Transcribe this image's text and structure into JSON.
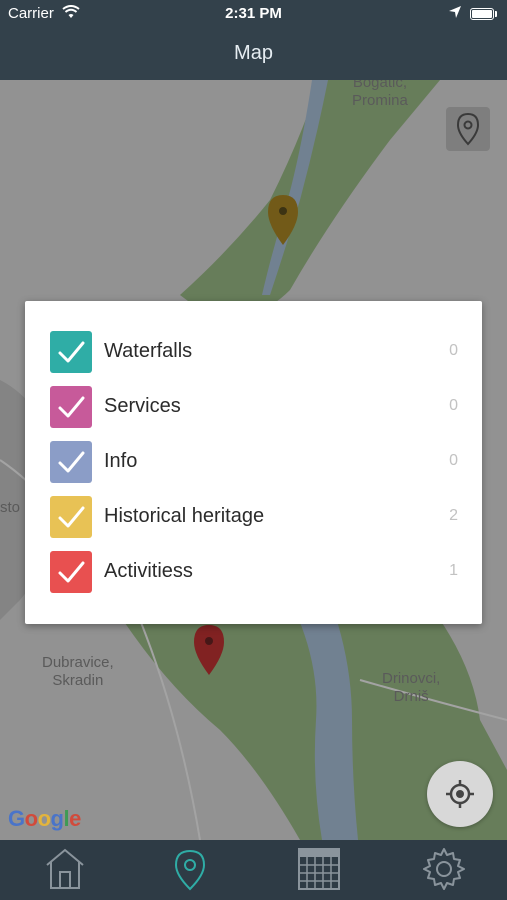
{
  "status_bar": {
    "carrier": "Carrier",
    "time": "2:31 PM"
  },
  "nav": {
    "title": "Map"
  },
  "map": {
    "places": [
      {
        "name": "Bogatić,",
        "name2": "Promina"
      },
      {
        "name": "Dubravice,",
        "name2": "Skradin"
      },
      {
        "name": "Drinovci,",
        "name2": "Drniš"
      },
      {
        "name": "sto"
      }
    ],
    "logo": "Google"
  },
  "filter": {
    "items": [
      {
        "label": "Waterfalls",
        "count": "0",
        "color": "#2fada6"
      },
      {
        "label": "Services",
        "count": "0",
        "color": "#c75a9a"
      },
      {
        "label": "Info",
        "count": "0",
        "color": "#8b9dc7"
      },
      {
        "label": "Historical heritage",
        "count": "2",
        "color": "#e8c255"
      },
      {
        "label": "Activitiess",
        "count": "1",
        "color": "#e85050"
      }
    ]
  },
  "tabbar": {
    "items": [
      "home-icon",
      "map-pin-icon",
      "calendar-icon",
      "gear-icon"
    ],
    "active_color": "#2fada6"
  },
  "colors": {
    "bar": "#33414b",
    "park_green": "#8fb27a",
    "water": "#9fb9d2"
  }
}
